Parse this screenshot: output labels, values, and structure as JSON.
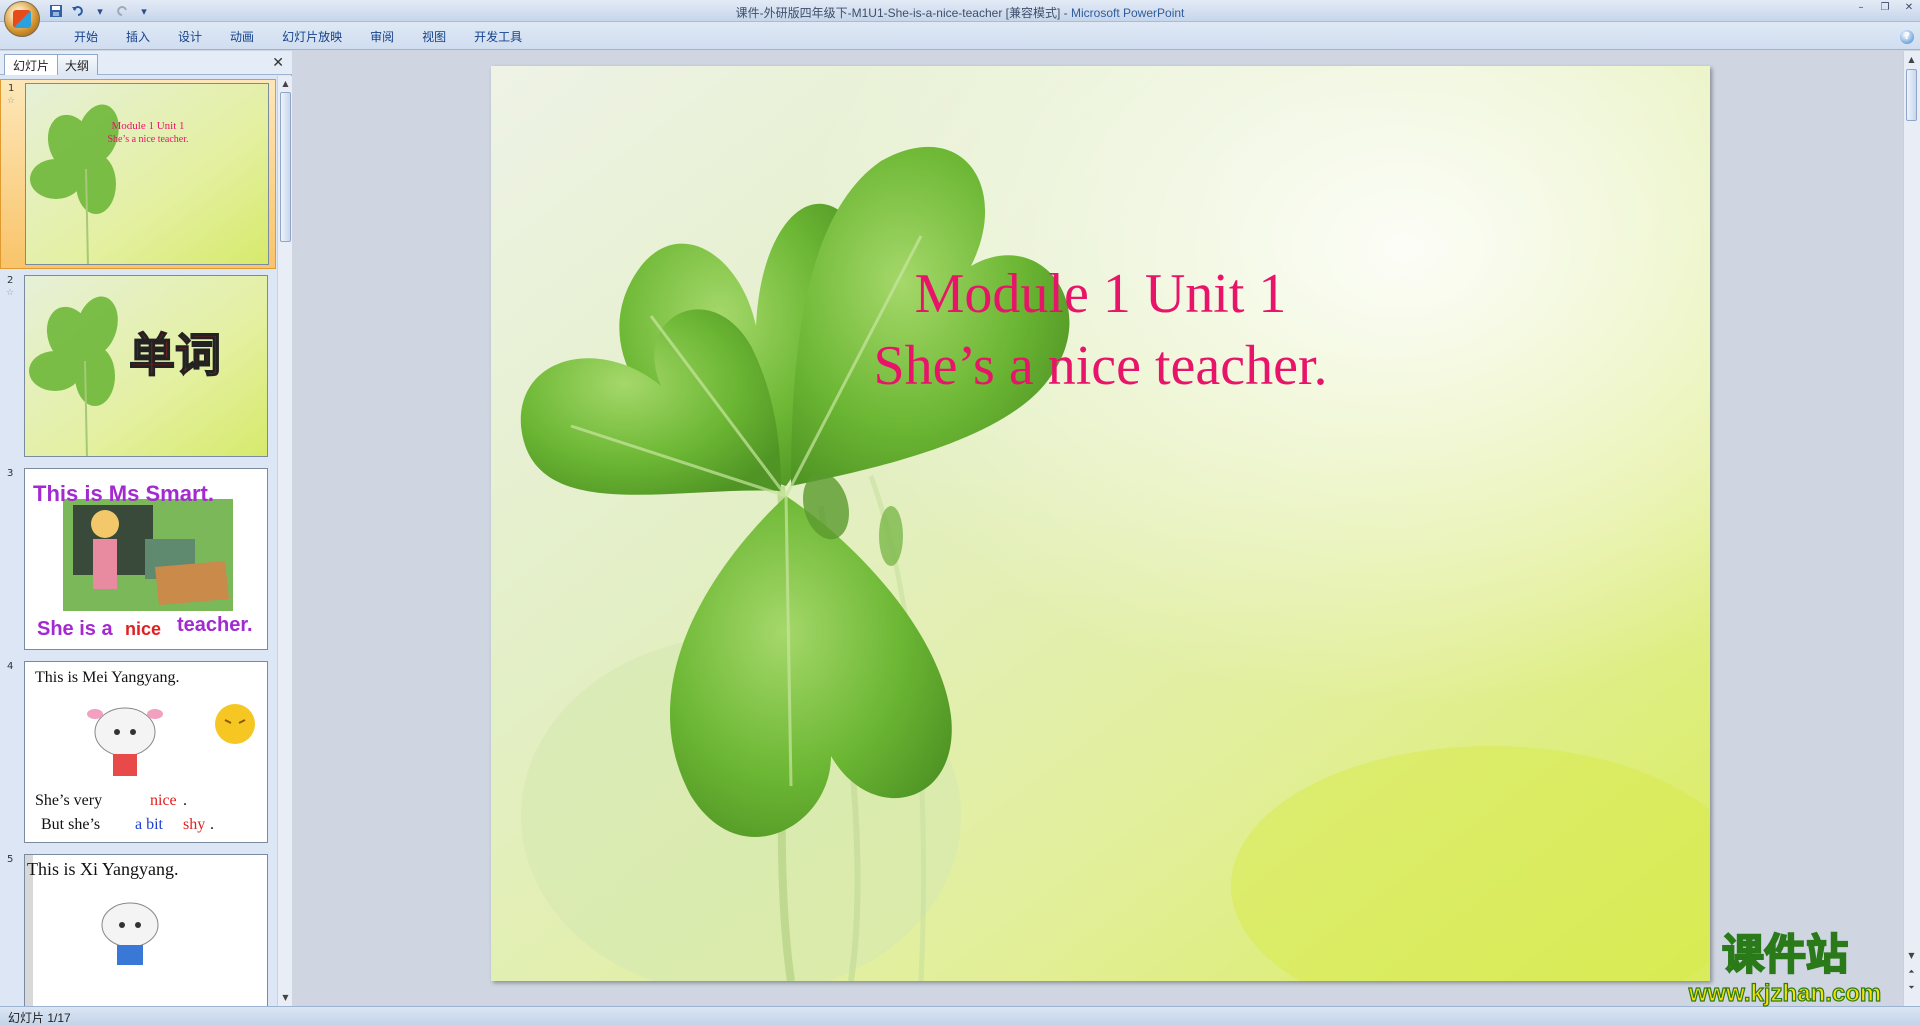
{
  "window": {
    "title": "课件-外研版四年级下-M1U1-She-is-a-nice-teacher [兼容模式]",
    "separator": " - ",
    "app_name": "Microsoft PowerPoint"
  },
  "quick_access": {
    "save_icon": "save-icon",
    "undo_icon": "undo-icon",
    "redo_icon": "redo-icon"
  },
  "ribbon": {
    "tabs": [
      "开始",
      "插入",
      "设计",
      "动画",
      "幻灯片放映",
      "审阅",
      "视图",
      "开发工具"
    ]
  },
  "left_pane": {
    "tabs": [
      "幻灯片",
      "大纲"
    ],
    "close": "✕"
  },
  "thumbnails": [
    {
      "number": "1",
      "title_line1": "Module 1 Unit 1",
      "title_line2": "She’s a nice teacher."
    },
    {
      "number": "2",
      "text": "单词"
    },
    {
      "number": "3",
      "line1": "This is Ms Smart.",
      "line2_a": "She is a",
      "line2_b": "nice",
      "line2_c": "teacher."
    },
    {
      "number": "4",
      "line1": "This is Mei Yangyang.",
      "line2_a": "She’s  very",
      "line2_b": "nice",
      "line2_c": " .",
      "line3_a": "But she’s",
      "line3_b": "a bit",
      "line3_c": "shy",
      "line3_d": "."
    },
    {
      "number": "5",
      "line1": "This is Xi Yangyang."
    }
  ],
  "slide": {
    "title_line1": "Module 1 Unit 1",
    "title_line2": "She’s a nice teacher."
  },
  "status": {
    "text": "幻灯片 1/17"
  },
  "watermark": {
    "line1": "课件站",
    "line2": "www.kjzhan.com"
  },
  "colors": {
    "title_pink": "#e8146a",
    "leaf_green": "#5ea92a",
    "background_lime": "#dcee8a"
  }
}
